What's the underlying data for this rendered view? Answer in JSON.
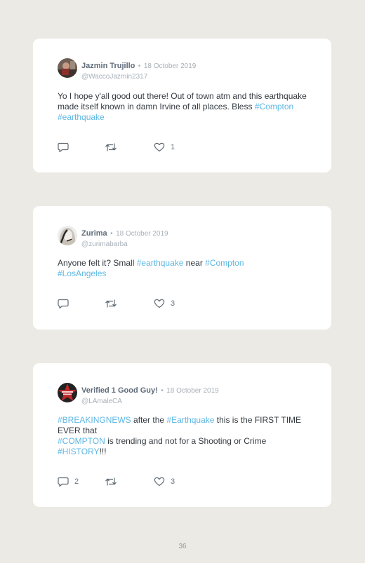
{
  "page_number": "36",
  "icons": {
    "reply": "comment-icon",
    "retweet": "retweet-icon",
    "like": "heart-icon"
  },
  "colors": {
    "hashtag": "#5db7e3",
    "name": "#5e6b79",
    "meta": "#a7b0b8",
    "card": "#ffffff",
    "page": "#eceae4"
  },
  "tweets": [
    {
      "name": "Jazmin Trujillo",
      "separator": "•",
      "date": "18 October 2019",
      "handle": "@WaccoJazmin2317",
      "text": [
        "Yo I hope y'all good out there! Out of town atm and this earthquake made itself known in damn Irvine of all places. Bless ",
        "#Compton",
        " ",
        "#earthquake"
      ],
      "reply_count": "",
      "retweet_count": "",
      "like_count": "1"
    },
    {
      "name": "Zurima",
      "separator": "•",
      "date": "18 October 2019",
      "handle": "@zurimabarba",
      "text": [
        "Anyone felt it? Small ",
        "#earthquake",
        " near ",
        "#Compton",
        "#LosAngeles"
      ],
      "reply_count": "",
      "retweet_count": "",
      "like_count": "3"
    },
    {
      "name": "Verified 1 Good Guy!",
      "separator": "•",
      "date": "18 October 2019",
      "handle": "@LAmaleCA",
      "text": [
        "#BREAKINGNEWS",
        " after the ",
        "#Earthquake",
        " this is the FIRST TIME EVER that",
        "#COMPTON",
        " is trending and not for a Shooting or Crime",
        "#HISTORY",
        "!!!"
      ],
      "reply_count": "2",
      "retweet_count": "",
      "like_count": "3"
    }
  ]
}
